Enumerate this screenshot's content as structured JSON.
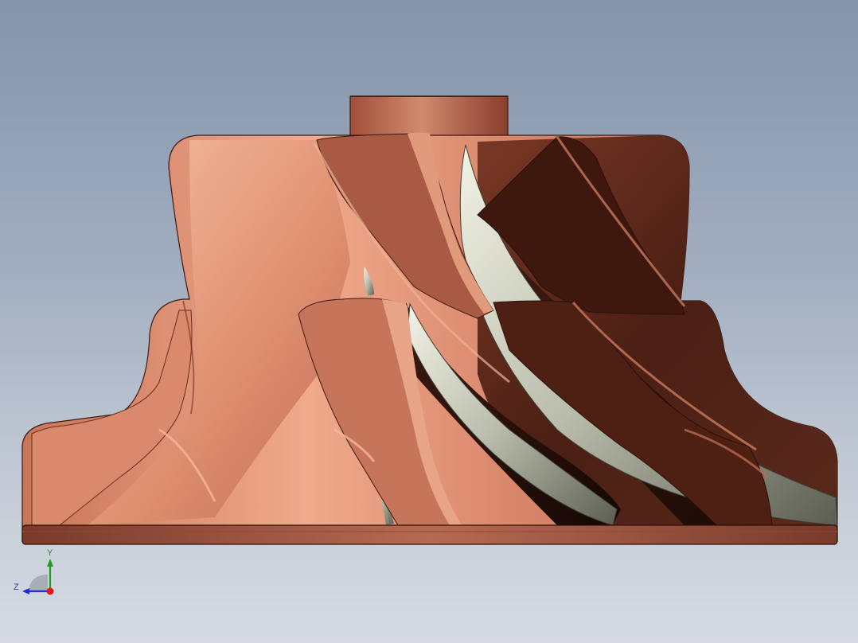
{
  "viewport": {
    "model": "impeller",
    "colors": {
      "background_top": "#8494ab",
      "background_bottom": "#d6dbe3",
      "copper_light": "#f3b296",
      "copper_mid": "#d07a5f",
      "copper_dark": "#6a2c1c",
      "passage_dark": "#1e0d08",
      "steel": "#c9cbbd"
    }
  },
  "triad": {
    "y_label": "Y",
    "z_label": "Z",
    "colors": {
      "y": "#1aa01a",
      "z": "#1e2fcf",
      "x": "#e01818"
    }
  }
}
